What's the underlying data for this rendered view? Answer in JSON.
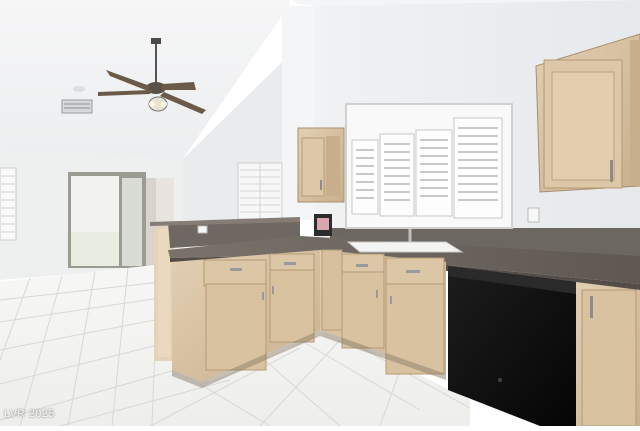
{
  "photo": {
    "subject": "kitchen-interior",
    "watermark": "LVR 2025"
  },
  "colors": {
    "wall": "#eef0f1",
    "ceiling": "#f1f2f3",
    "cabinet": "#d6c1a2",
    "cabinet_shadow": "#b79f7f",
    "countertop": "#6e6660",
    "tile_floor": "#f3f3f1",
    "dishwasher": "#111111"
  }
}
